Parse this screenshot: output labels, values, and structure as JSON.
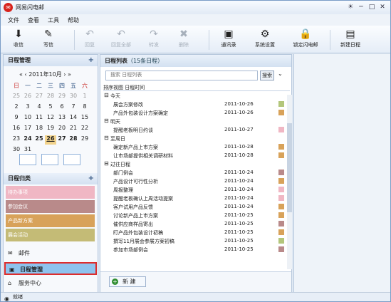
{
  "window": {
    "title": "网易闪电邮"
  },
  "menu": [
    "文件",
    "查看",
    "工具",
    "帮助"
  ],
  "toolbar": {
    "receive": "收信",
    "compose": "写信",
    "reply": "回复",
    "reply_all": "回复全部",
    "forward": "转发",
    "delete": "删除",
    "contacts": "通讯录",
    "settings": "系统设置",
    "lock": "锁定闪电邮",
    "new_schedule": "新建日程"
  },
  "sidebar": {
    "schedule_panel": "日程管理",
    "month": "2011年10月",
    "week": [
      "日",
      "一",
      "二",
      "三",
      "四",
      "五",
      "六"
    ],
    "days": [
      [
        "25",
        "26",
        "27",
        "28",
        "29",
        "30",
        "1"
      ],
      [
        "2",
        "3",
        "4",
        "5",
        "6",
        "7",
        "8"
      ],
      [
        "9",
        "10",
        "11",
        "12",
        "13",
        "14",
        "15"
      ],
      [
        "16",
        "17",
        "18",
        "19",
        "20",
        "21",
        "22"
      ],
      [
        "23",
        "24",
        "25",
        "26",
        "27",
        "28",
        "29"
      ],
      [
        "30",
        "31",
        "",
        "",
        "",
        "",
        ""
      ]
    ],
    "category_panel": "日程归类",
    "categories": [
      {
        "label": "待办事项",
        "color": "#f0b7c4"
      },
      {
        "label": "参加会议",
        "color": "#b98a8a"
      },
      {
        "label": "产品新方案",
        "color": "#d8a25a"
      },
      {
        "label": "展会活动",
        "color": "#c4bb76"
      }
    ],
    "nav": [
      {
        "label": "邮件",
        "icon": "mail-icon"
      },
      {
        "label": "日程管理",
        "icon": "calendar-icon"
      },
      {
        "label": "服务中心",
        "icon": "service-icon"
      }
    ]
  },
  "list": {
    "title": "日程列表",
    "count": "（15条日程）",
    "search_placeholder": "搜索 日程列表",
    "search_button": "搜索",
    "header": "排序视图",
    "header_col": "日程时间",
    "groups": [
      {
        "label": "今天",
        "items": [
          {
            "title": "展会方案修改",
            "date": "2011-10-26",
            "color": "#b3c67b"
          },
          {
            "title": "产品外包装设计方案确定",
            "date": "2011-10-26",
            "color": "#d8a25a"
          }
        ]
      },
      {
        "label": "明天",
        "items": [
          {
            "title": "提醒老板明日约谈",
            "date": "2011-10-27",
            "color": "#f0b7c4"
          }
        ]
      },
      {
        "label": "至周日",
        "items": [
          {
            "title": "确定新产品上市方案",
            "date": "2011-10-28",
            "color": "#d8a25a"
          },
          {
            "title": "让市场部提供相关调研材料",
            "date": "2011-10-28",
            "color": "#d8a25a"
          }
        ]
      },
      {
        "label": "过往日程",
        "items": [
          {
            "title": "部门例会",
            "date": "2011-10-24",
            "color": "#b98a8a"
          },
          {
            "title": "产品设计可行性分析",
            "date": "2011-10-24",
            "color": "#d8a25a"
          },
          {
            "title": "周报整理",
            "date": "2011-10-24",
            "color": "#f0b7c4"
          },
          {
            "title": "提醒老板确认上周活动提案",
            "date": "2011-10-24",
            "color": "#f0b7c4"
          },
          {
            "title": "客户试用产品反馈",
            "date": "2011-10-24",
            "color": "#d8a25a"
          },
          {
            "title": "讨论新产品上市方案",
            "date": "2011-10-25",
            "color": "#d8a25a"
          },
          {
            "title": "催供应商样品寄出",
            "date": "2011-10-25",
            "color": "#b98a8a"
          },
          {
            "title": "盯产品外包装设计初稿",
            "date": "2011-10-25",
            "color": "#d8a25a"
          },
          {
            "title": "撰写11月展会参展方案初稿",
            "date": "2011-10-25",
            "color": "#b3c67b"
          },
          {
            "title": "参加市场部例会",
            "date": "2011-10-25",
            "color": "#b98a8a"
          }
        ]
      }
    ],
    "new_button": "新 建"
  },
  "status": {
    "text": "就绪"
  }
}
